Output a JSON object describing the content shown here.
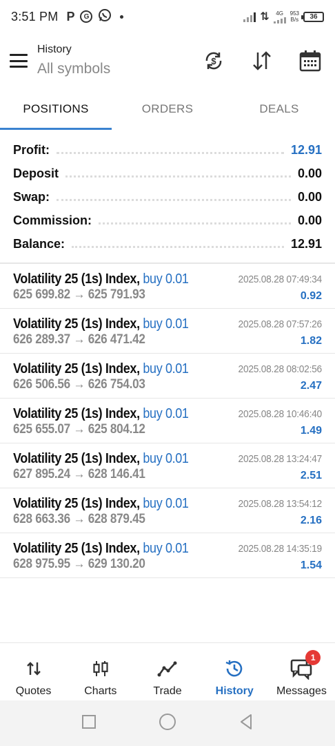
{
  "status_bar": {
    "time": "3:51 PM",
    "app_icons": [
      "P",
      "ⓖ",
      "whatsapp"
    ],
    "network": "4G",
    "speed_value": "953",
    "speed_unit": "B/s",
    "battery": "36"
  },
  "header": {
    "title": "History",
    "subtitle": "All symbols"
  },
  "tabs": [
    {
      "label": "POSITIONS",
      "active": true
    },
    {
      "label": "ORDERS",
      "active": false
    },
    {
      "label": "DEALS",
      "active": false
    }
  ],
  "summary": [
    {
      "label": "Profit:",
      "value": "12.91",
      "accent": true
    },
    {
      "label": "Deposit",
      "value": "0.00",
      "accent": false
    },
    {
      "label": "Swap:",
      "value": "0.00",
      "accent": false
    },
    {
      "label": "Commission:",
      "value": "0.00",
      "accent": false
    },
    {
      "label": "Balance:",
      "value": "12.91",
      "accent": false
    }
  ],
  "positions": [
    {
      "symbol": "Volatility 25 (1s) Index,",
      "side": "buy 0.01",
      "open": "625 699.82",
      "arrow": "→",
      "close": "625 791.93",
      "time": "2025.08.28 07:49:34",
      "profit": "0.92"
    },
    {
      "symbol": "Volatility 25 (1s) Index,",
      "side": "buy 0.01",
      "open": "626 289.37",
      "arrow": "→",
      "close": "626 471.42",
      "time": "2025.08.28 07:57:26",
      "profit": "1.82"
    },
    {
      "symbol": "Volatility 25 (1s) Index,",
      "side": "buy 0.01",
      "open": "626 506.56",
      "arrow": "→",
      "close": "626 754.03",
      "time": "2025.08.28 08:02:56",
      "profit": "2.47"
    },
    {
      "symbol": "Volatility 25 (1s) Index,",
      "side": "buy 0.01",
      "open": "625 655.07",
      "arrow": "→",
      "close": "625 804.12",
      "time": "2025.08.28 10:46:40",
      "profit": "1.49"
    },
    {
      "symbol": "Volatility 25 (1s) Index,",
      "side": "buy 0.01",
      "open": "627 895.24",
      "arrow": "→",
      "close": "628 146.41",
      "time": "2025.08.28 13:24:47",
      "profit": "2.51"
    },
    {
      "symbol": "Volatility 25 (1s) Index,",
      "side": "buy 0.01",
      "open": "628 663.36",
      "arrow": "→",
      "close": "628 879.45",
      "time": "2025.08.28 13:54:12",
      "profit": "2.16"
    },
    {
      "symbol": "Volatility 25 (1s) Index,",
      "side": "buy 0.01",
      "open": "628 975.95",
      "arrow": "→",
      "close": "629 130.20",
      "time": "2025.08.28 14:35:19",
      "profit": "1.54"
    }
  ],
  "bottom_nav": [
    {
      "label": "Quotes",
      "icon": "quotes-arrows-icon",
      "active": false
    },
    {
      "label": "Charts",
      "icon": "candlestick-icon",
      "active": false
    },
    {
      "label": "Trade",
      "icon": "trade-line-icon",
      "active": false
    },
    {
      "label": "History",
      "icon": "history-clock-icon",
      "active": true
    },
    {
      "label": "Messages",
      "icon": "chat-bubbles-icon",
      "active": false,
      "badge": "1"
    }
  ],
  "colors": {
    "accent": "#2670c2",
    "tab_indicator": "#3a82d0",
    "muted": "#888888",
    "badge": "#e53935"
  }
}
